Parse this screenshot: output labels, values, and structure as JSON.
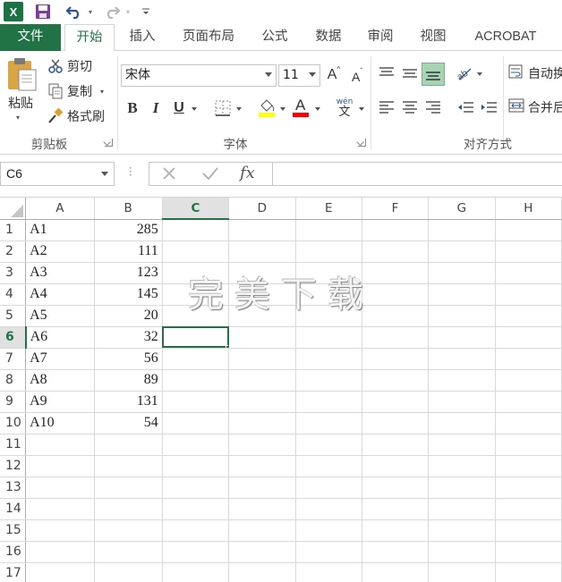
{
  "app": {
    "logo_text": "X",
    "accent": "#217346"
  },
  "quick_access": {
    "save_icon": "save-icon",
    "undo_icon": "undo-icon",
    "redo_icon": "redo-icon"
  },
  "tabs": [
    {
      "label": "文件"
    },
    {
      "label": "开始"
    },
    {
      "label": "插入"
    },
    {
      "label": "页面布局"
    },
    {
      "label": "公式"
    },
    {
      "label": "数据"
    },
    {
      "label": "审阅"
    },
    {
      "label": "视图"
    },
    {
      "label": "ACROBAT"
    }
  ],
  "ribbon": {
    "clipboard": {
      "paste": "粘贴",
      "cut": "剪切",
      "copy": "复制",
      "format_painter": "格式刷",
      "group_label": "剪贴板"
    },
    "font": {
      "font_name": "宋体",
      "font_size": "11",
      "grow": "A",
      "shrink": "A",
      "bold": "B",
      "italic": "I",
      "underline": "U",
      "font_color_letter": "A",
      "phonetic_top": "wén",
      "phonetic_bottom": "文",
      "group_label": "字体"
    },
    "alignment": {
      "wrap_text": "自动换",
      "merge_center": "合并后",
      "group_label": "对齐方式"
    }
  },
  "formula_bar": {
    "name_box": "C6",
    "fx": "fx",
    "value": ""
  },
  "sheet": {
    "columns": [
      "A",
      "B",
      "C",
      "D",
      "E",
      "F",
      "G",
      "H"
    ],
    "selected_column": "C",
    "selected_row": 6,
    "rows": [
      {
        "n": "1",
        "a": "A1",
        "b": "285"
      },
      {
        "n": "2",
        "a": "A2",
        "b": "111"
      },
      {
        "n": "3",
        "a": "A3",
        "b": "123"
      },
      {
        "n": "4",
        "a": "A4",
        "b": "145"
      },
      {
        "n": "5",
        "a": "A5",
        "b": "20"
      },
      {
        "n": "6",
        "a": "A6",
        "b": "32"
      },
      {
        "n": "7",
        "a": "A7",
        "b": "56"
      },
      {
        "n": "8",
        "a": "A8",
        "b": "89"
      },
      {
        "n": "9",
        "a": "A9",
        "b": "131"
      },
      {
        "n": "10",
        "a": "A10",
        "b": "54"
      },
      {
        "n": "11",
        "a": "",
        "b": ""
      },
      {
        "n": "12",
        "a": "",
        "b": ""
      },
      {
        "n": "13",
        "a": "",
        "b": ""
      },
      {
        "n": "14",
        "a": "",
        "b": ""
      },
      {
        "n": "15",
        "a": "",
        "b": ""
      },
      {
        "n": "16",
        "a": "",
        "b": ""
      },
      {
        "n": "17",
        "a": "",
        "b": ""
      }
    ]
  },
  "watermark": "完美下载"
}
